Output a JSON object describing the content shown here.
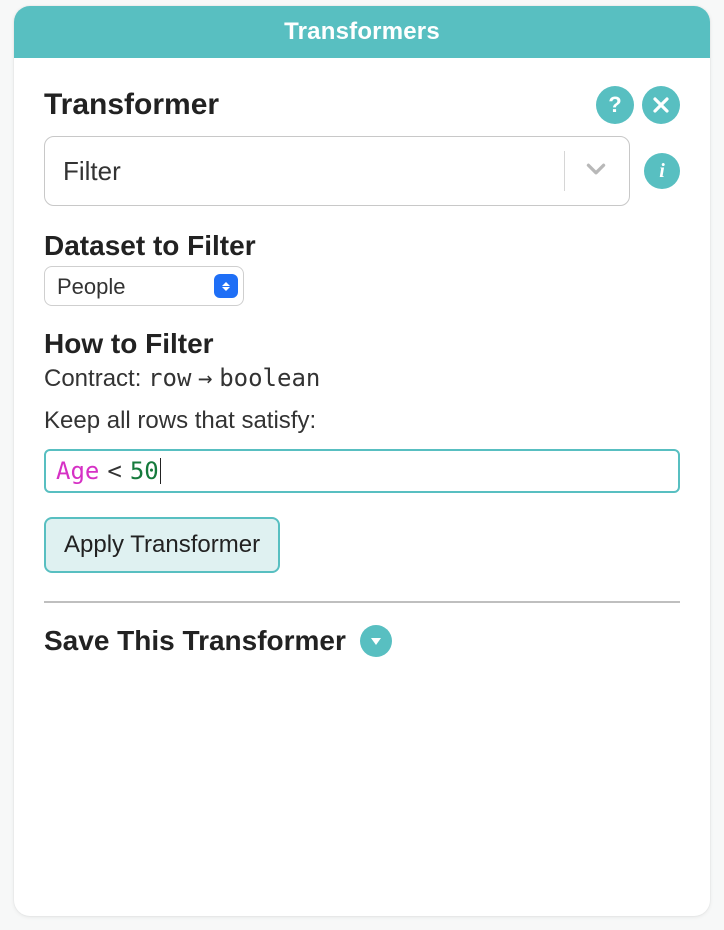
{
  "panel": {
    "title": "Transformers"
  },
  "transformer": {
    "label": "Transformer",
    "selected": "Filter"
  },
  "dataset": {
    "label": "Dataset to Filter",
    "selected": "People"
  },
  "howto": {
    "label": "How to Filter",
    "contract_label": "Contract:",
    "contract_from": "row",
    "contract_arrow": "→",
    "contract_to": "boolean",
    "keep_label": "Keep all rows that satisfy:",
    "expr": {
      "field": "Age",
      "op": "<",
      "value": "50"
    }
  },
  "apply": {
    "label": "Apply Transformer"
  },
  "save": {
    "label": "Save This Transformer"
  }
}
